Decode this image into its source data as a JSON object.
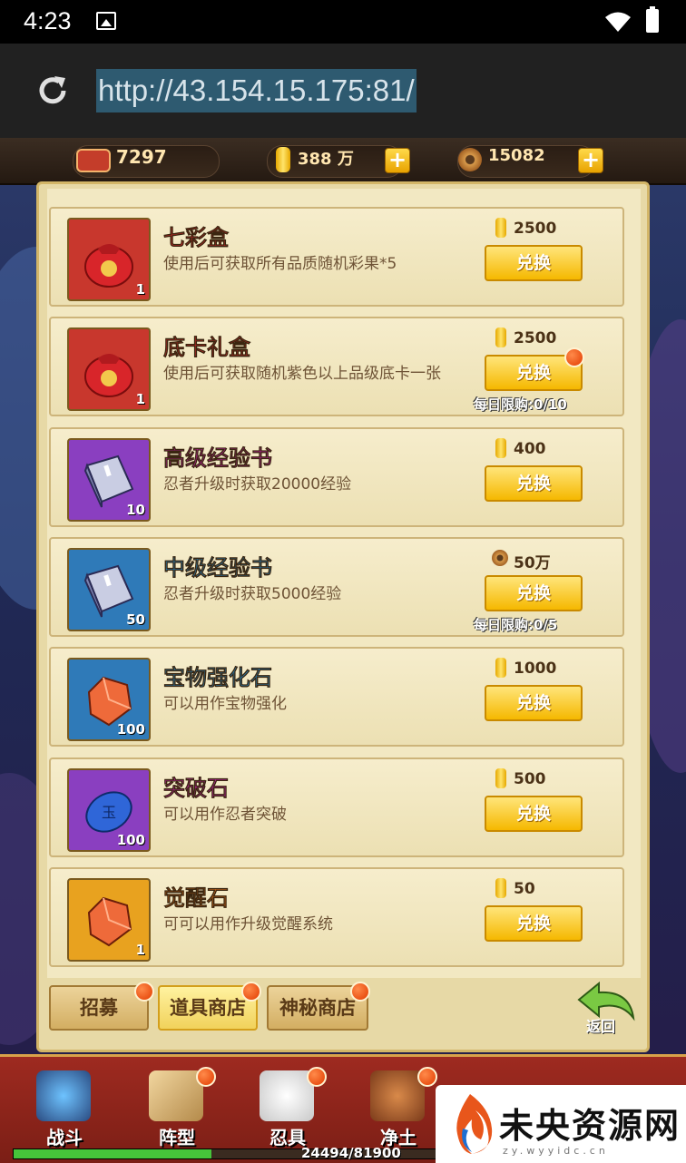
{
  "status_bar": {
    "time": "4:23"
  },
  "browser": {
    "url": "http://43.154.15.175:81/"
  },
  "resources": {
    "tickets": "7297",
    "gold": "388 万",
    "coins": "15082"
  },
  "shop": {
    "items": [
      {
        "name": "七彩盒",
        "name_color": "#d2262b",
        "desc": "使用后可获取所有品质随机彩果*5",
        "qty": "1",
        "price": "2500",
        "currency": "gold",
        "button": "兑换",
        "limit": "",
        "badge": false,
        "icon_bg": "#c8372d",
        "icon_art": "red-bag"
      },
      {
        "name": "底卡礼盒",
        "name_color": "#d2262b",
        "desc": "使用后可获取随机紫色以上品级底卡一张",
        "qty": "1",
        "price": "2500",
        "currency": "gold",
        "button": "兑换",
        "limit": "每日限购:0/10",
        "badge": true,
        "icon_bg": "#c8372d",
        "icon_art": "red-bag"
      },
      {
        "name": "高级经验书",
        "name_color": "#d21fb8",
        "desc": "忍者升级时获取20000经验",
        "qty": "10",
        "price": "400",
        "currency": "gold",
        "button": "兑换",
        "limit": "",
        "badge": false,
        "icon_bg": "#8a3fc0",
        "icon_art": "book"
      },
      {
        "name": "中级经验书",
        "name_color": "#1f8ed2",
        "desc": "忍者升级时获取5000经验",
        "qty": "50",
        "price": "50万",
        "currency": "coin",
        "button": "兑换",
        "limit": "每日限购:0/5",
        "badge": false,
        "icon_bg": "#2f7ab8",
        "icon_art": "book"
      },
      {
        "name": "宝物强化石",
        "name_color": "#1f8ed2",
        "desc": "可以用作宝物强化",
        "qty": "100",
        "price": "1000",
        "currency": "gold",
        "button": "兑换",
        "limit": "",
        "badge": false,
        "icon_bg": "#2f7ab8",
        "icon_art": "stone-orange"
      },
      {
        "name": "突破石",
        "name_color": "#d21fb8",
        "desc": "可以用作忍者突破",
        "qty": "100",
        "price": "500",
        "currency": "gold",
        "button": "兑换",
        "limit": "",
        "badge": false,
        "icon_bg": "#8a3fc0",
        "icon_art": "stone-blue"
      },
      {
        "name": "觉醒石",
        "name_color": "#e0701a",
        "desc": "可可以用作升级觉醒系统",
        "qty": "1",
        "price": "50",
        "currency": "gold",
        "button": "兑换",
        "limit": "",
        "badge": false,
        "icon_bg": "#e8a21f",
        "icon_art": "stone-orange"
      }
    ]
  },
  "tabs": [
    "招募",
    "道具商店",
    "神秘商店"
  ],
  "back_label": "返回",
  "bottom_nav": {
    "items": [
      "战斗",
      "阵型",
      "忍具",
      "净土"
    ],
    "xp": "24494/81900",
    "xp_fraction": 0.299
  },
  "watermark": {
    "title": "未央资源网",
    "sub": "zy.wyyidc.cn"
  }
}
